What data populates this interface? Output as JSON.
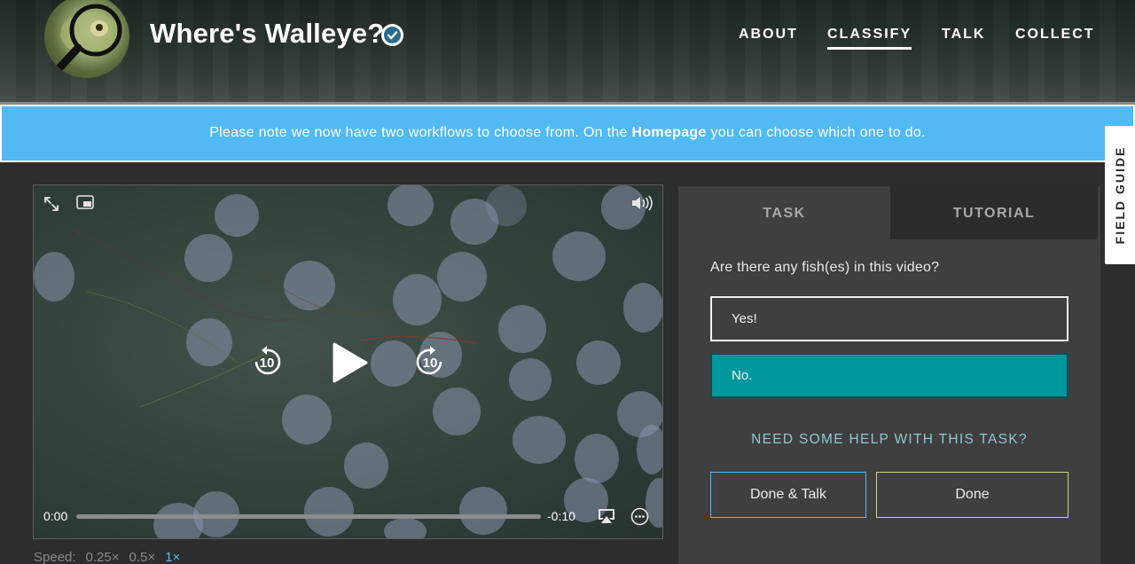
{
  "header": {
    "title": "Where's Walleye?",
    "nav": [
      {
        "label": "ABOUT"
      },
      {
        "label": "CLASSIFY",
        "active": true
      },
      {
        "label": "TALK"
      },
      {
        "label": "COLLECT"
      }
    ]
  },
  "banner": {
    "text_before": "Please note we now have two workflows to choose from. On the ",
    "link_text": "Homepage",
    "text_after": " you can choose which one to do."
  },
  "field_guide": {
    "label": "FIELD GUIDE"
  },
  "video": {
    "current_time": "0:00",
    "remaining_time": "-0:10",
    "skip_back_seconds": "10",
    "skip_forward_seconds": "10",
    "progress_fraction": 0,
    "icons": [
      "fullscreen-icon",
      "picture-in-picture-icon",
      "volume-icon",
      "rewind-10-icon",
      "play-icon",
      "forward-10-icon",
      "airplay-icon",
      "more-options-icon"
    ]
  },
  "speed": {
    "label": "Speed:",
    "options": [
      "0.25×",
      "0.5×",
      "1×"
    ],
    "selected": "1×"
  },
  "task_panel": {
    "tabs": [
      {
        "label": "TASK",
        "active": true
      },
      {
        "label": "TUTORIAL"
      }
    ],
    "question": "Are there any fish(es) in this video?",
    "answers": [
      {
        "label": "Yes!",
        "selected": false
      },
      {
        "label": "No.",
        "selected": true
      }
    ],
    "help_link": "NEED SOME HELP WITH THIS TASK?",
    "buttons": {
      "done_talk": "Done & Talk",
      "done": "Done"
    }
  },
  "colors": {
    "accent_blue": "#52b9f3",
    "selected_answer": "#00979d",
    "done_border": "#c3d98a",
    "help_text": "#8ec7cf"
  }
}
